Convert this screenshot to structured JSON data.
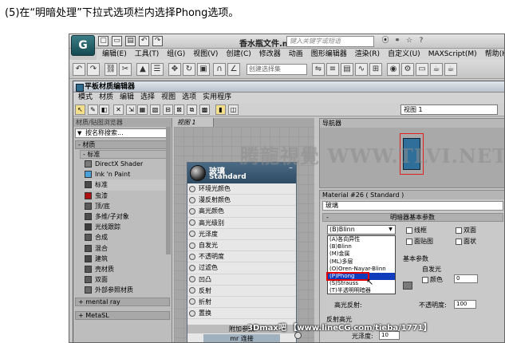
{
  "caption": "(5)在“明暗处理”下拉式选项栏内选择Phong选项。",
  "app": {
    "logo": "G",
    "file_title": "香水瓶文件.max",
    "search_placeholder": "键入关键字或短语",
    "quick_icons": [
      "▢",
      "▭",
      "▤",
      "↶",
      "↷"
    ],
    "title_icons": [
      "⦿",
      "⚭",
      "☆",
      "?"
    ],
    "menu": [
      "编辑(E)",
      "工具(T)",
      "组(G)",
      "视图(V)",
      "创建(C)",
      "修改器",
      "动画",
      "图形编辑器",
      "渲染(R)",
      "自定义(U)",
      "MAXScript(M)",
      "帮助(H)"
    ],
    "selection_set_placeholder": "创建选择集"
  },
  "editor": {
    "title": "平板材质编辑器",
    "menu": [
      "模式",
      "材质",
      "编辑",
      "选择",
      "视图",
      "选项",
      "实用程序"
    ],
    "view_select": "视图 1",
    "browser": {
      "header": "材质/贴图浏览器",
      "search_placeholder": "按名称搜索...",
      "group_materials": "- 材质",
      "subgroup_standard": "- 标准",
      "items": [
        {
          "label": "DirectX Shader",
          "color": "#7a7a7a"
        },
        {
          "label": "Ink 'n Paint",
          "color": "#4aa0d8"
        },
        {
          "label": "标准",
          "color": "#4a4a4a"
        },
        {
          "label": "虫漆",
          "color": "#b01010"
        },
        {
          "label": "顶/底",
          "color": "#5a5a5a"
        },
        {
          "label": "多维/子对象",
          "color": "#4c4c4c"
        },
        {
          "label": "光线跟踪",
          "color": "#3c3c3c"
        },
        {
          "label": "合成",
          "color": "#585858"
        },
        {
          "label": "混合",
          "color": "#505050"
        },
        {
          "label": "建筑",
          "color": "#464646"
        },
        {
          "label": "壳材质",
          "color": "#545454"
        },
        {
          "label": "双面",
          "color": "#5c5c5c"
        },
        {
          "label": "外部参照材质",
          "color": "#6a6a6a"
        }
      ],
      "group_mental_ray": "+ mental ray",
      "group_metasl": "+ MetaSL"
    },
    "view_tab": "视图 1",
    "node": {
      "name": "玻璃",
      "type": "Standard",
      "close": "–",
      "slots": [
        "环境光颜色",
        "漫反射颜色",
        "高光颜色",
        "高光级别",
        "光泽度",
        "自发光",
        "不透明度",
        "过滤色",
        "凹凸",
        "反射",
        "折射",
        "置换"
      ],
      "footer1": "附加参数",
      "footer2": "mr 连接"
    },
    "navigator_header": "导航器",
    "watermark": "腾龍視覺 WWW.TLVI.NET",
    "params": {
      "header": "Material #26  ( Standard )",
      "material_name": "玻璃",
      "rollout_title": "明暗器基本参数",
      "rollout_prefix": "-",
      "shader_selected": "(B)Blinn",
      "checks": [
        "线框",
        "双面",
        "面贴图",
        "面状"
      ],
      "shader_list": [
        "(A)各向异性",
        "(B)Blinn",
        "(M)金属",
        "(ML)多层",
        "(O)Oren-Nayar-Blinn",
        "(P)Phong",
        "(S)Strauss",
        "(T)半透明明暗器"
      ],
      "highlight_index": 5,
      "basic_params_title": "基本参数",
      "self_illum_label": "自发光",
      "color_label": "颜色",
      "color_value": "0",
      "opacity_label": "不透明度:",
      "opacity_value": "100",
      "spec_reflect_label": "高光反射:",
      "reflect_hl_label": "反射高光",
      "gloss_label": "光泽度:",
      "gloss_value": "10"
    }
  },
  "footer_watermark": "3Dmax吧 【www.lineCG.com/tieba/1771】",
  "colors": {
    "node_header": "#2e4b63",
    "list_highlight": "#113bbd",
    "callout_red": "#e00000"
  }
}
